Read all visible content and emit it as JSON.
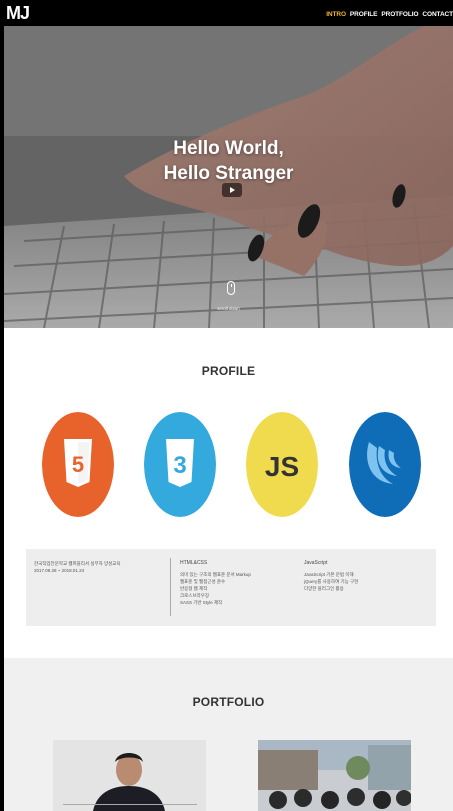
{
  "nav": {
    "logo": "MJ",
    "items": [
      {
        "label": "INTRO",
        "active": true
      },
      {
        "label": "PROFILE",
        "active": false
      },
      {
        "label": "PROTFOLIO",
        "active": false
      },
      {
        "label": "CONTACT",
        "active": false
      }
    ],
    "active_color": "#f5b52a"
  },
  "hero": {
    "title_line1": "Hello World,",
    "title_line2": "Hello Stranger",
    "scroll_label": "scroll down"
  },
  "profile": {
    "title": "PROFILE",
    "skills": [
      {
        "name": "html5-icon",
        "text": "5",
        "color": "#e8632b"
      },
      {
        "name": "css3-icon",
        "text": "3",
        "color": "#33a9de"
      },
      {
        "name": "javascript-icon",
        "text": "JS",
        "color": "#f0db4f"
      },
      {
        "name": "jquery-icon",
        "text": "",
        "color": "#0f6cb7"
      }
    ],
    "info": {
      "col1_line1": "한국직업전문학교 웹퍼블리셔 실무자 양성교육",
      "col1_line2": "2017.08.28 ~ 2018.01.24",
      "col2_head": "HTML&CSS",
      "col2_items": [
        "의미 있는 구조의 웹표준 문서 Markup",
        "웹표준 및 웹접근성 준수",
        "반응형 웹 제작",
        "크로스브라우징",
        "SASS 기반 Style 제작"
      ],
      "col3_head": "JavaScript",
      "col3_items": [
        "JavaScript 기본 문법 이해",
        "jQuery를 사용하여 기능 구현",
        "다양한 플러그인 활용"
      ]
    }
  },
  "portfolio": {
    "title": "PORTFOLIO"
  }
}
